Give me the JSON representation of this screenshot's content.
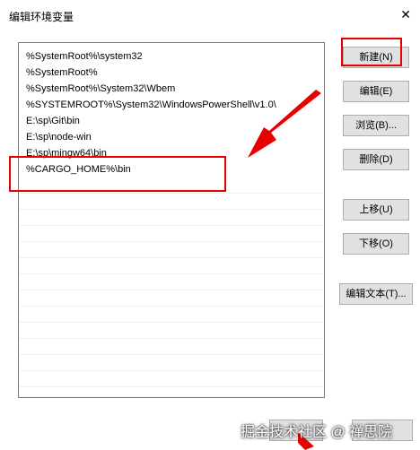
{
  "window": {
    "title": "编辑环境变量",
    "close_label": "✕"
  },
  "list": {
    "items": [
      "%SystemRoot%\\system32",
      "%SystemRoot%",
      "%SystemRoot%\\System32\\Wbem",
      "%SYSTEMROOT%\\System32\\WindowsPowerShell\\v1.0\\",
      "E:\\sp\\Git\\bin",
      "E:\\sp\\node-win",
      "E:\\sp\\mingw64\\bin",
      "%CARGO_HOME%\\bin"
    ]
  },
  "buttons": {
    "new": "新建(N)",
    "edit": "编辑(E)",
    "browse": "浏览(B)...",
    "delete": "删除(D)",
    "move_up": "上移(U)",
    "move_down": "下移(O)",
    "edit_text": "编辑文本(T)..."
  },
  "watermark": "掘金技术社区 @ 禅思院",
  "colors": {
    "highlight": "#e60000",
    "button_bg": "#e1e1e1",
    "list_border": "#7a7a7a"
  }
}
